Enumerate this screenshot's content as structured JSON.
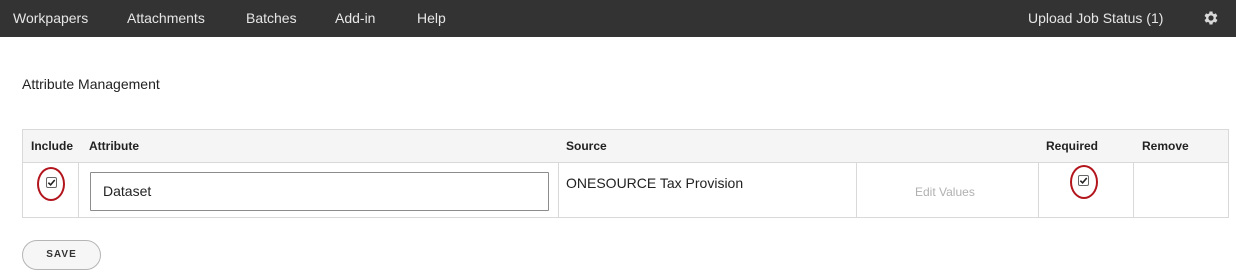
{
  "nav": {
    "items": [
      {
        "label": "Workpapers"
      },
      {
        "label": "Attachments"
      },
      {
        "label": "Batches"
      },
      {
        "label": "Add-in"
      },
      {
        "label": "Help"
      }
    ],
    "upload_status": "Upload Job Status (1)",
    "settings_icon": "gear-icon"
  },
  "page": {
    "title": "Attribute Management"
  },
  "table": {
    "headers": {
      "include": "Include",
      "attribute": "Attribute",
      "source": "Source",
      "required": "Required",
      "remove": "Remove"
    },
    "rows": [
      {
        "include": true,
        "attribute": "Dataset",
        "source": "ONESOURCE Tax Provision",
        "edit_values": "Edit Values",
        "required": true
      }
    ]
  },
  "actions": {
    "save_label": "SAVE"
  },
  "colors": {
    "topbar": "#333333",
    "highlight_circle": "#b3151d"
  }
}
